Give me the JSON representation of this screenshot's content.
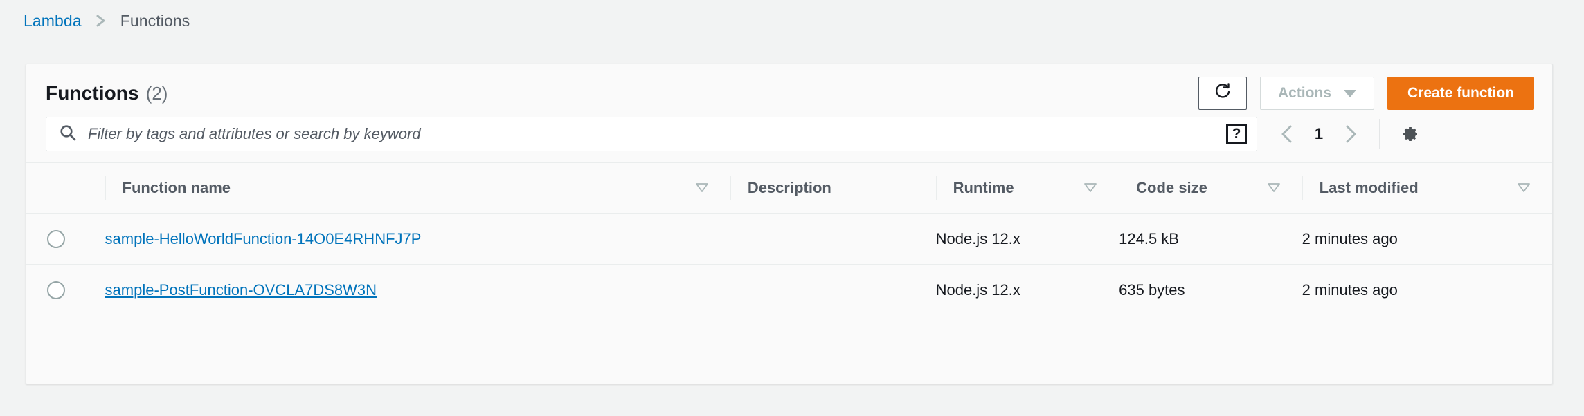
{
  "breadcrumb": {
    "root_label": "Lambda",
    "separator_icon": "chevron-right-icon",
    "current_label": "Functions"
  },
  "panel": {
    "title": "Functions",
    "count_label": "(2)",
    "refresh_icon": "refresh-icon",
    "actions_label": "Actions",
    "actions_caret_icon": "caret-down-icon",
    "create_label": "Create function",
    "create_button_color": "#ec7211"
  },
  "search": {
    "icon": "search-icon",
    "value": "",
    "placeholder": "Filter by tags and attributes or search by keyword",
    "help_label": "?"
  },
  "pagination": {
    "prev_icon": "chevron-left-icon",
    "page_label": "1",
    "next_icon": "chevron-right-icon",
    "settings_icon": "gear-icon"
  },
  "table": {
    "columns": [
      {
        "label": "",
        "sortable": false
      },
      {
        "label": "Function name",
        "sortable": true
      },
      {
        "label": "Description",
        "sortable": false
      },
      {
        "label": "Runtime",
        "sortable": true
      },
      {
        "label": "Code size",
        "sortable": true
      },
      {
        "label": "Last modified",
        "sortable": true
      }
    ],
    "rows": [
      {
        "selected": false,
        "name": "sample-HelloWorldFunction-14O0E4RHNFJ7P",
        "description": "",
        "runtime": "Node.js 12.x",
        "code_size": "124.5 kB",
        "last_modified": "2 minutes ago",
        "hovered": false
      },
      {
        "selected": false,
        "name": "sample-PostFunction-OVCLA7DS8W3N",
        "description": "",
        "runtime": "Node.js 12.x",
        "code_size": "635 bytes",
        "last_modified": "2 minutes ago",
        "hovered": true
      }
    ]
  }
}
